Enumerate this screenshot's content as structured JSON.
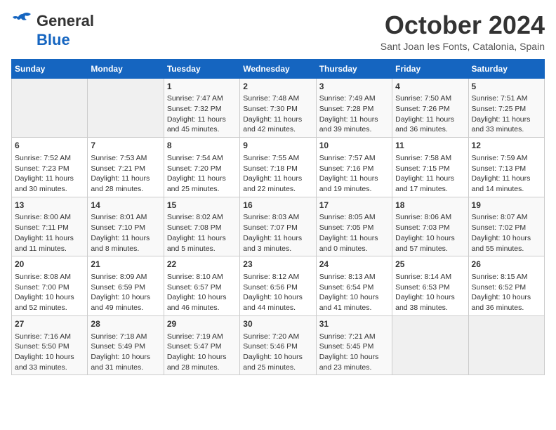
{
  "header": {
    "logo_line1": "General",
    "logo_line2": "Blue",
    "month": "October 2024",
    "location": "Sant Joan les Fonts, Catalonia, Spain"
  },
  "days_of_week": [
    "Sunday",
    "Monday",
    "Tuesday",
    "Wednesday",
    "Thursday",
    "Friday",
    "Saturday"
  ],
  "weeks": [
    [
      {
        "day": "",
        "content": ""
      },
      {
        "day": "",
        "content": ""
      },
      {
        "day": "1",
        "content": "Sunrise: 7:47 AM\nSunset: 7:32 PM\nDaylight: 11 hours and 45 minutes."
      },
      {
        "day": "2",
        "content": "Sunrise: 7:48 AM\nSunset: 7:30 PM\nDaylight: 11 hours and 42 minutes."
      },
      {
        "day": "3",
        "content": "Sunrise: 7:49 AM\nSunset: 7:28 PM\nDaylight: 11 hours and 39 minutes."
      },
      {
        "day": "4",
        "content": "Sunrise: 7:50 AM\nSunset: 7:26 PM\nDaylight: 11 hours and 36 minutes."
      },
      {
        "day": "5",
        "content": "Sunrise: 7:51 AM\nSunset: 7:25 PM\nDaylight: 11 hours and 33 minutes."
      }
    ],
    [
      {
        "day": "6",
        "content": "Sunrise: 7:52 AM\nSunset: 7:23 PM\nDaylight: 11 hours and 30 minutes."
      },
      {
        "day": "7",
        "content": "Sunrise: 7:53 AM\nSunset: 7:21 PM\nDaylight: 11 hours and 28 minutes."
      },
      {
        "day": "8",
        "content": "Sunrise: 7:54 AM\nSunset: 7:20 PM\nDaylight: 11 hours and 25 minutes."
      },
      {
        "day": "9",
        "content": "Sunrise: 7:55 AM\nSunset: 7:18 PM\nDaylight: 11 hours and 22 minutes."
      },
      {
        "day": "10",
        "content": "Sunrise: 7:57 AM\nSunset: 7:16 PM\nDaylight: 11 hours and 19 minutes."
      },
      {
        "day": "11",
        "content": "Sunrise: 7:58 AM\nSunset: 7:15 PM\nDaylight: 11 hours and 17 minutes."
      },
      {
        "day": "12",
        "content": "Sunrise: 7:59 AM\nSunset: 7:13 PM\nDaylight: 11 hours and 14 minutes."
      }
    ],
    [
      {
        "day": "13",
        "content": "Sunrise: 8:00 AM\nSunset: 7:11 PM\nDaylight: 11 hours and 11 minutes."
      },
      {
        "day": "14",
        "content": "Sunrise: 8:01 AM\nSunset: 7:10 PM\nDaylight: 11 hours and 8 minutes."
      },
      {
        "day": "15",
        "content": "Sunrise: 8:02 AM\nSunset: 7:08 PM\nDaylight: 11 hours and 5 minutes."
      },
      {
        "day": "16",
        "content": "Sunrise: 8:03 AM\nSunset: 7:07 PM\nDaylight: 11 hours and 3 minutes."
      },
      {
        "day": "17",
        "content": "Sunrise: 8:05 AM\nSunset: 7:05 PM\nDaylight: 11 hours and 0 minutes."
      },
      {
        "day": "18",
        "content": "Sunrise: 8:06 AM\nSunset: 7:03 PM\nDaylight: 10 hours and 57 minutes."
      },
      {
        "day": "19",
        "content": "Sunrise: 8:07 AM\nSunset: 7:02 PM\nDaylight: 10 hours and 55 minutes."
      }
    ],
    [
      {
        "day": "20",
        "content": "Sunrise: 8:08 AM\nSunset: 7:00 PM\nDaylight: 10 hours and 52 minutes."
      },
      {
        "day": "21",
        "content": "Sunrise: 8:09 AM\nSunset: 6:59 PM\nDaylight: 10 hours and 49 minutes."
      },
      {
        "day": "22",
        "content": "Sunrise: 8:10 AM\nSunset: 6:57 PM\nDaylight: 10 hours and 46 minutes."
      },
      {
        "day": "23",
        "content": "Sunrise: 8:12 AM\nSunset: 6:56 PM\nDaylight: 10 hours and 44 minutes."
      },
      {
        "day": "24",
        "content": "Sunrise: 8:13 AM\nSunset: 6:54 PM\nDaylight: 10 hours and 41 minutes."
      },
      {
        "day": "25",
        "content": "Sunrise: 8:14 AM\nSunset: 6:53 PM\nDaylight: 10 hours and 38 minutes."
      },
      {
        "day": "26",
        "content": "Sunrise: 8:15 AM\nSunset: 6:52 PM\nDaylight: 10 hours and 36 minutes."
      }
    ],
    [
      {
        "day": "27",
        "content": "Sunrise: 7:16 AM\nSunset: 5:50 PM\nDaylight: 10 hours and 33 minutes."
      },
      {
        "day": "28",
        "content": "Sunrise: 7:18 AM\nSunset: 5:49 PM\nDaylight: 10 hours and 31 minutes."
      },
      {
        "day": "29",
        "content": "Sunrise: 7:19 AM\nSunset: 5:47 PM\nDaylight: 10 hours and 28 minutes."
      },
      {
        "day": "30",
        "content": "Sunrise: 7:20 AM\nSunset: 5:46 PM\nDaylight: 10 hours and 25 minutes."
      },
      {
        "day": "31",
        "content": "Sunrise: 7:21 AM\nSunset: 5:45 PM\nDaylight: 10 hours and 23 minutes."
      },
      {
        "day": "",
        "content": ""
      },
      {
        "day": "",
        "content": ""
      }
    ]
  ]
}
